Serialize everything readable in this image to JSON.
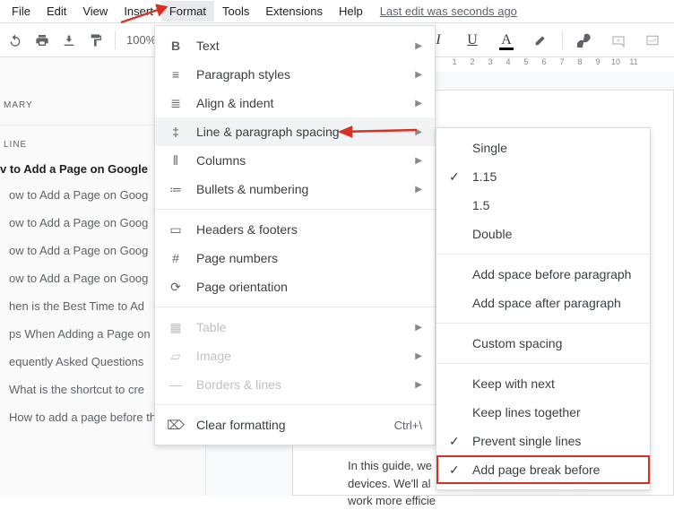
{
  "menubar": {
    "items": [
      "File",
      "Edit",
      "View",
      "Insert",
      "Format",
      "Tools",
      "Extensions",
      "Help"
    ],
    "active_index": 4,
    "last_edit": "Last edit was seconds ago"
  },
  "toolbar": {
    "zoom": "100%"
  },
  "ruler_ticks": [
    "1",
    "2",
    "3",
    "4",
    "5",
    "6",
    "7",
    "8",
    "9",
    "10",
    "11"
  ],
  "sidebar": {
    "summary_label": "MARY",
    "outline_label": "LINE",
    "outline_title": "v to Add a Page on Google",
    "items": [
      "ow to Add a Page on Goog",
      "ow to Add a Page on Goog",
      "ow to Add a Page on Goog",
      "ow to Add a Page on Goog",
      "hen is the Best Time to Ad",
      "ps When Adding a Page on",
      "equently Asked Questions",
      "What is the shortcut to cre",
      "How to add a page before th…"
    ]
  },
  "format_menu": {
    "items": [
      {
        "icon": "B",
        "label": "Text",
        "arrow": true
      },
      {
        "icon": "¶",
        "label": "Paragraph styles",
        "arrow": true
      },
      {
        "icon": "≡",
        "label": "Align & indent",
        "arrow": true
      },
      {
        "icon": "‡",
        "label": "Line & paragraph spacing",
        "arrow": true,
        "hover": true
      },
      {
        "icon": "⫴",
        "label": "Columns",
        "arrow": true
      },
      {
        "icon": "≔",
        "label": "Bullets & numbering",
        "arrow": true
      }
    ],
    "group2": [
      {
        "icon": "▭",
        "label": "Headers & footers"
      },
      {
        "icon": "#",
        "label": "Page numbers"
      },
      {
        "icon": "⟲",
        "label": "Page orientation"
      }
    ],
    "group3": [
      {
        "icon": "▦",
        "label": "Table",
        "arrow": true,
        "disabled": true
      },
      {
        "icon": "▱",
        "label": "Image",
        "arrow": true,
        "disabled": true
      },
      {
        "icon": "—",
        "label": "Borders & lines",
        "arrow": true,
        "disabled": true
      }
    ],
    "group4": [
      {
        "icon": "✕",
        "label": "Clear formatting",
        "shortcut": "Ctrl+\\"
      }
    ]
  },
  "submenu": {
    "spacing": [
      {
        "label": "Single",
        "checked": false
      },
      {
        "label": "1.15",
        "checked": true
      },
      {
        "label": "1.5",
        "checked": false
      },
      {
        "label": "Double",
        "checked": false
      }
    ],
    "para": [
      {
        "label": "Add space before paragraph"
      },
      {
        "label": "Add space after paragraph"
      }
    ],
    "custom": [
      {
        "label": "Custom spacing"
      }
    ],
    "keep": [
      {
        "label": "Keep with next",
        "checked": false
      },
      {
        "label": "Keep lines together",
        "checked": false
      },
      {
        "label": "Prevent single lines",
        "checked": true
      },
      {
        "label": "Add page break before",
        "checked": true,
        "highlight": true
      }
    ]
  },
  "doc_text": {
    "l1": "In this guide, we",
    "l2": "devices. We'll al",
    "l3": "work more efficie"
  }
}
